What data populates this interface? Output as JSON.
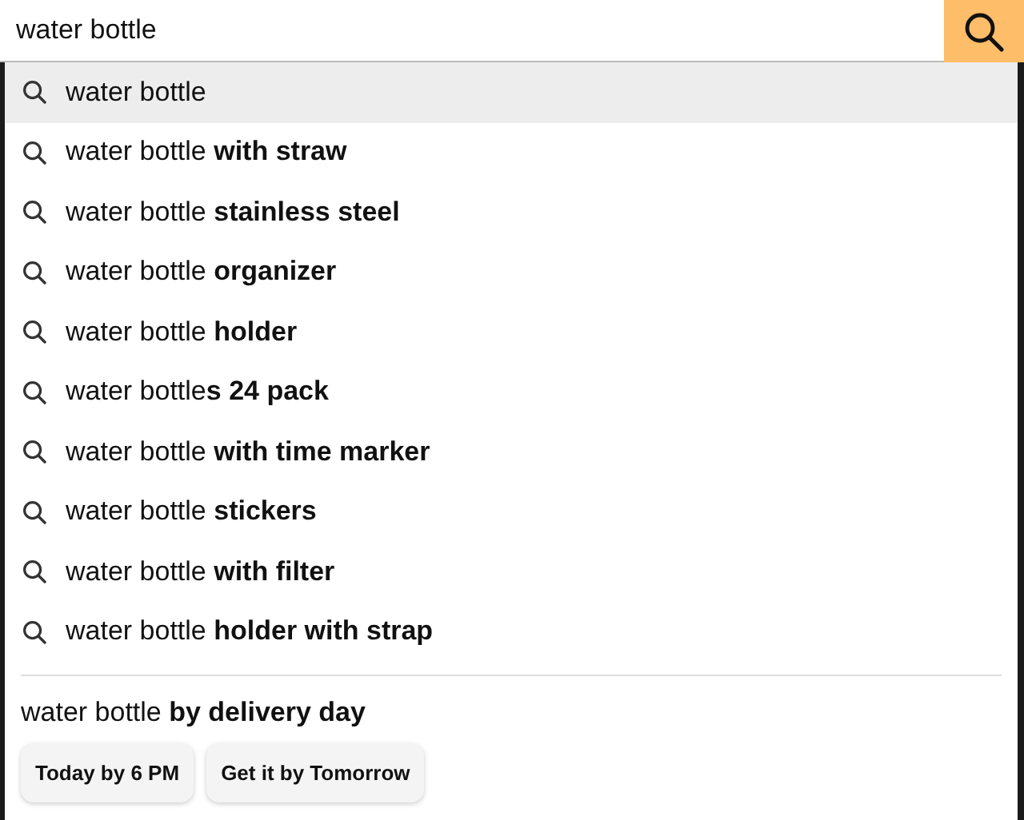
{
  "search": {
    "value": "water bottle"
  },
  "suggestions": [
    {
      "text": "water bottle",
      "selected": true
    },
    {
      "text": "water bottle **with straw**",
      "selected": false
    },
    {
      "text": "water bottle **stainless steel**",
      "selected": false
    },
    {
      "text": "water bottle **organizer**",
      "selected": false
    },
    {
      "text": "water bottle **holder**",
      "selected": false
    },
    {
      "text": "water bottle**s 24 pack**",
      "selected": false
    },
    {
      "text": "water bottle **with time marker**",
      "selected": false
    },
    {
      "text": "water bottle **stickers**",
      "selected": false
    },
    {
      "text": "water bottle **with filter**",
      "selected": false
    },
    {
      "text": "water bottle **holder with strap**",
      "selected": false
    }
  ],
  "delivery": {
    "heading": "water bottle **by delivery day**",
    "buttons": [
      "Today by 6 PM",
      "Get it by Tomorrow"
    ]
  }
}
